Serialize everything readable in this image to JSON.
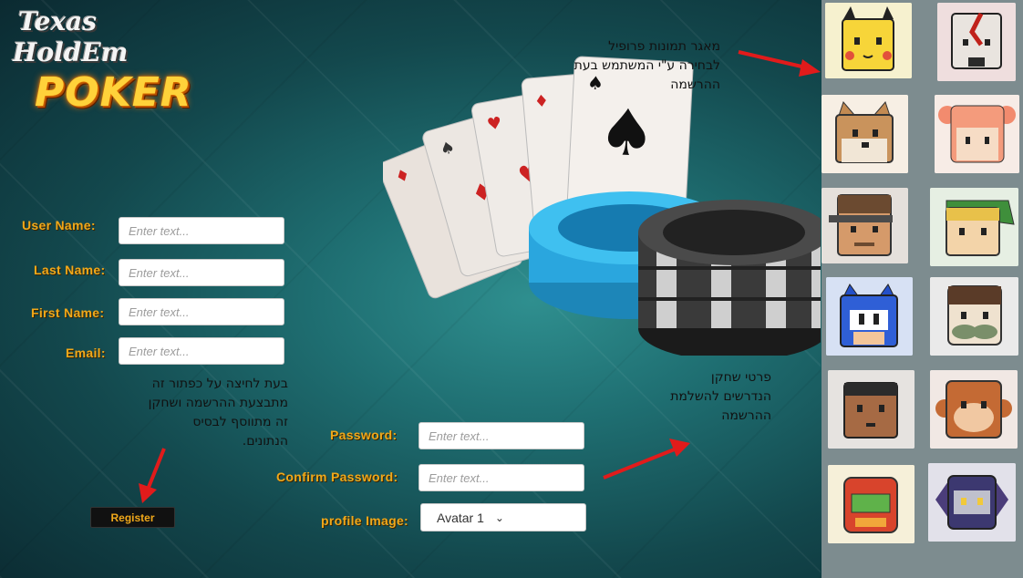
{
  "logo": {
    "line1": "Texas",
    "line2": "HoldEm",
    "line3": "POKER"
  },
  "form": {
    "user_name": {
      "label": "User Name:",
      "placeholder": "Enter text..."
    },
    "last_name": {
      "label": "Last Name:",
      "placeholder": "Enter text..."
    },
    "first_name": {
      "label": "First Name:",
      "placeholder": "Enter text..."
    },
    "email": {
      "label": "Email:",
      "placeholder": "Enter text..."
    },
    "password": {
      "label": "Password:",
      "placeholder": "Enter text..."
    },
    "confirm_password": {
      "label": "Confirm Password:",
      "placeholder": "Enter text..."
    },
    "profile_image": {
      "label": "profile Image:",
      "selected": "Avatar 1"
    },
    "register_label": "Register"
  },
  "notes": {
    "avatar_pool": [
      "מאגר תמונות פרופיל",
      "לבחירה ע\"י המשתמש בעת",
      "ההרשמה"
    ],
    "player_details": [
      "פרטי שחקן",
      "הנדרשים להשלמת",
      "ההרשמה"
    ],
    "register_help": [
      "בעת לחיצה על כפתור זה",
      "מתבצעת ההרשמה ושחקן",
      "זה מתווסף לבסיס",
      "הנתונים."
    ]
  },
  "avatars": [
    {
      "name": "pikachu-avatar",
      "bg": "#f6f1cf"
    },
    {
      "name": "kratos-avatar",
      "bg": "#efdede"
    },
    {
      "name": "fox-avatar",
      "bg": "#f7efe4"
    },
    {
      "name": "pink-hair-girl-avatar",
      "bg": "#f7ece6"
    },
    {
      "name": "snake-avatar",
      "bg": "#e5e0db"
    },
    {
      "name": "link-avatar",
      "bg": "#e6efe3"
    },
    {
      "name": "sonic-avatar",
      "bg": "#d7e1f4"
    },
    {
      "name": "mustache-hero-avatar",
      "bg": "#eaeaea"
    },
    {
      "name": "boy-avatar",
      "bg": "#e6e3e0"
    },
    {
      "name": "monkey-avatar",
      "bg": "#f1e8e4"
    },
    {
      "name": "samus-avatar",
      "bg": "#f6f0d9"
    },
    {
      "name": "metaknight-avatar",
      "bg": "#e2e1ea"
    }
  ],
  "colors": {
    "label": "#f0a81a",
    "arrow": "#e11b1b",
    "panel": "#7d8c8f"
  }
}
